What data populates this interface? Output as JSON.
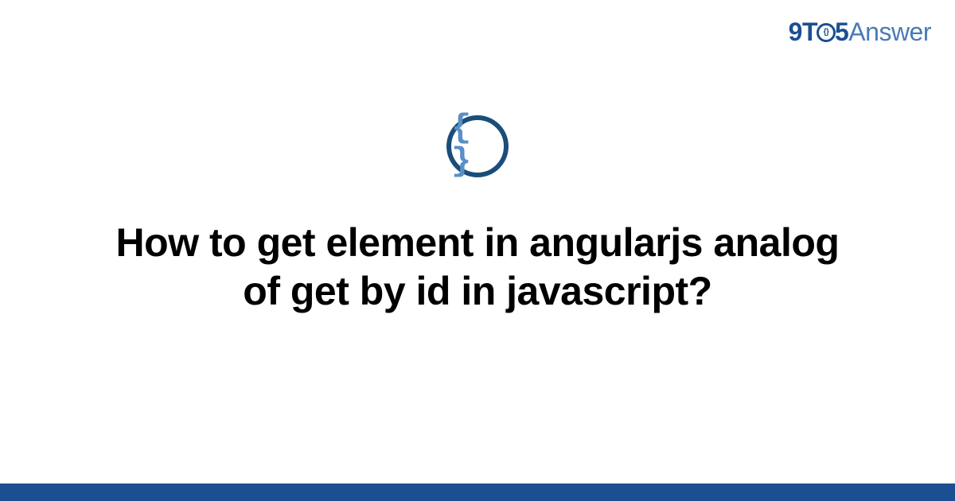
{
  "logo": {
    "part1": "9T",
    "part_o_inner": "{}",
    "part2": "5",
    "part3": "Answer"
  },
  "icon": {
    "name": "code-braces-icon",
    "glyph": "{ }"
  },
  "title": "How to get element in angularjs analog of get by id in javascript?",
  "colors": {
    "brand_dark": "#1b4f91",
    "brand_light": "#4a7bb5",
    "icon_border": "#1a4d7a",
    "icon_glyph": "#5a8fc7"
  }
}
